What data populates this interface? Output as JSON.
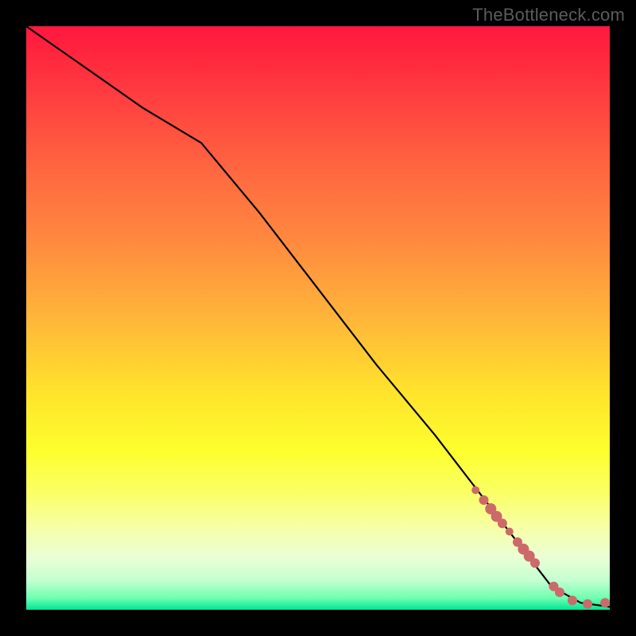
{
  "watermark": "TheBottleneck.com",
  "chart_data": {
    "type": "line",
    "xlim": [
      0,
      100
    ],
    "ylim": [
      0,
      100
    ],
    "grid": false,
    "legend": false,
    "title": "",
    "xlabel": "",
    "ylabel": "",
    "line": {
      "x": [
        0,
        10,
        20,
        30,
        40,
        50,
        60,
        70,
        80,
        90,
        95,
        100
      ],
      "y": [
        100,
        93,
        86,
        80,
        68,
        55,
        42,
        30,
        17,
        4,
        1.2,
        0.5
      ]
    },
    "markers": {
      "color": "#cc6a6a",
      "size_scale": [
        4,
        10
      ],
      "points": [
        {
          "x": 77.0,
          "y": 20.5,
          "size": 5
        },
        {
          "x": 78.4,
          "y": 18.8,
          "size": 6
        },
        {
          "x": 79.6,
          "y": 17.3,
          "size": 7
        },
        {
          "x": 80.6,
          "y": 16.0,
          "size": 7
        },
        {
          "x": 81.6,
          "y": 14.8,
          "size": 6
        },
        {
          "x": 82.8,
          "y": 13.4,
          "size": 5
        },
        {
          "x": 84.2,
          "y": 11.6,
          "size": 6
        },
        {
          "x": 85.2,
          "y": 10.4,
          "size": 7
        },
        {
          "x": 86.2,
          "y": 9.2,
          "size": 7
        },
        {
          "x": 87.2,
          "y": 8.0,
          "size": 6
        },
        {
          "x": 90.4,
          "y": 4.0,
          "size": 6
        },
        {
          "x": 91.4,
          "y": 3.0,
          "size": 6
        },
        {
          "x": 93.6,
          "y": 1.6,
          "size": 6
        },
        {
          "x": 96.2,
          "y": 1.0,
          "size": 6
        },
        {
          "x": 99.2,
          "y": 1.2,
          "size": 6
        }
      ]
    }
  }
}
